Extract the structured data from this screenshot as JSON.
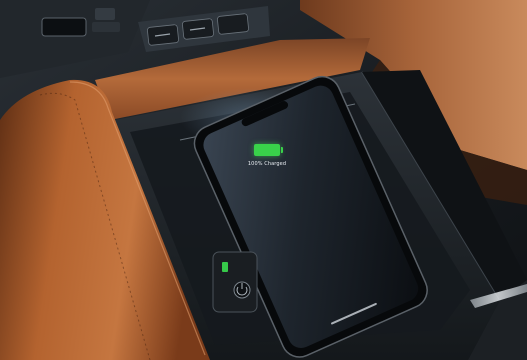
{
  "scene": {
    "phone_screen": {
      "charge_status_text": "100% Charged",
      "battery_level_percent": 100,
      "battery_color": "#39d24a"
    },
    "colors": {
      "leather": "#a85a2c",
      "leather_dark": "#6b3418",
      "trim_black": "#121518",
      "tray_surface": "#1c2024"
    }
  }
}
